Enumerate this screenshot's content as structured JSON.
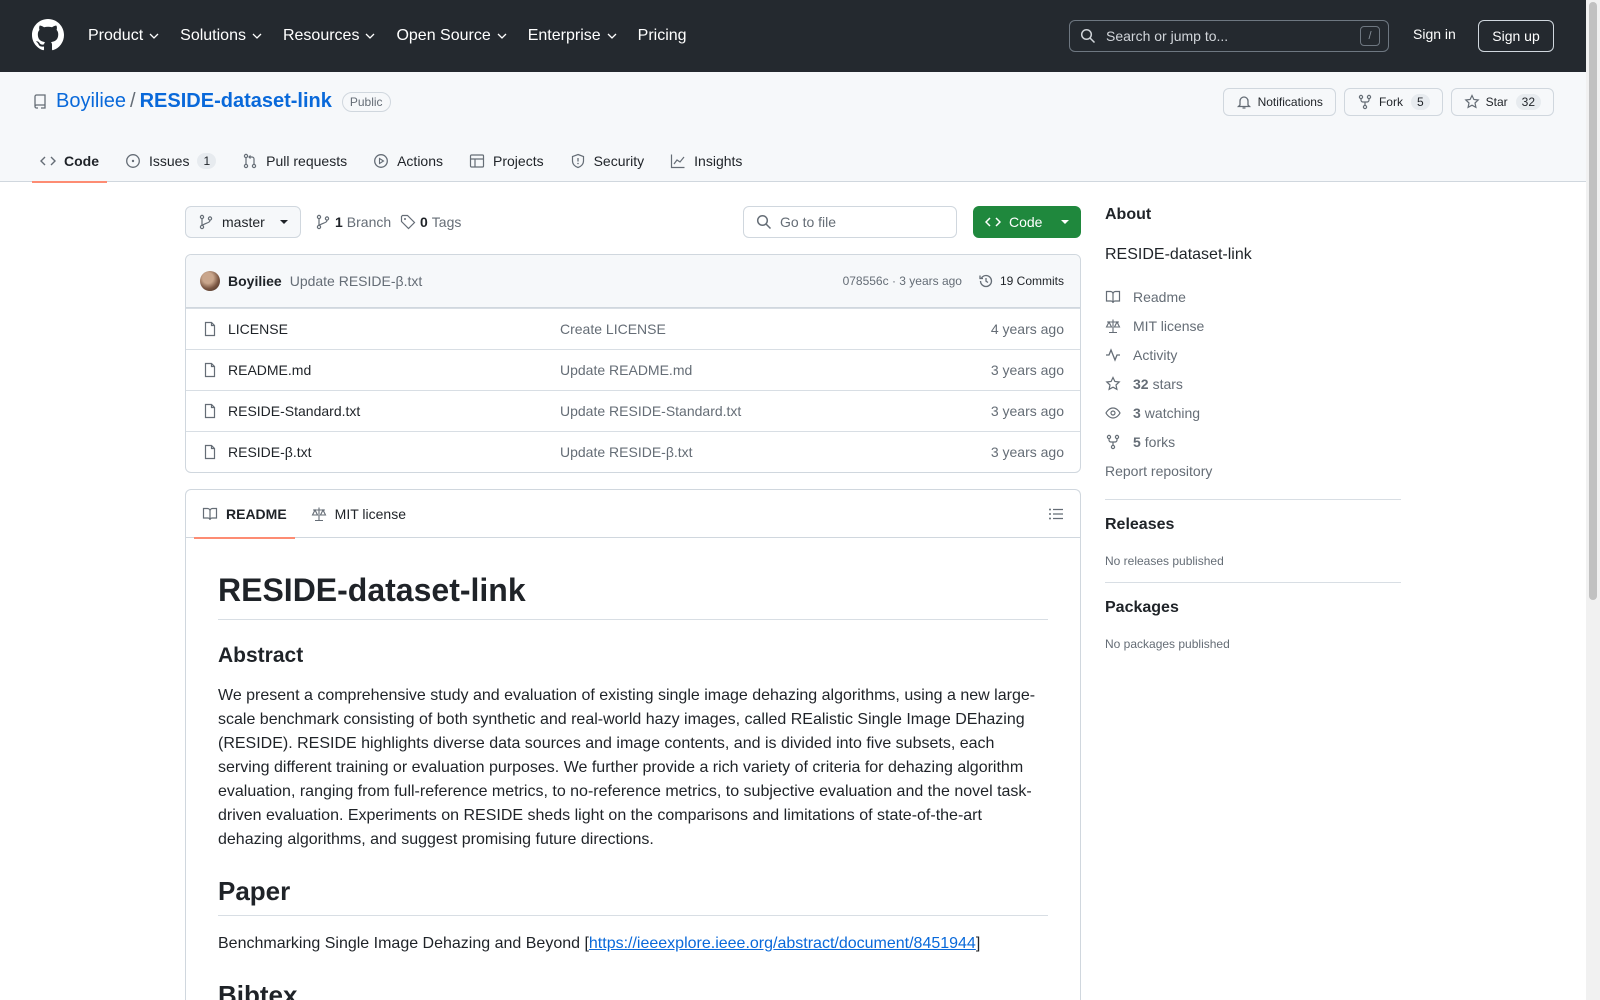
{
  "header": {
    "nav": [
      "Product",
      "Solutions",
      "Resources",
      "Open Source",
      "Enterprise",
      "Pricing"
    ],
    "search_placeholder": "Search or jump to...",
    "search_key": "/",
    "signin": "Sign in",
    "signup": "Sign up"
  },
  "repo": {
    "owner": "Boyiliee",
    "separator": "/",
    "name": "RESIDE-dataset-link",
    "visibility": "Public",
    "notifications_label": "Notifications",
    "fork_label": "Fork",
    "fork_count": "5",
    "star_label": "Star",
    "star_count": "32"
  },
  "tabs": [
    {
      "label": "Code",
      "icon": "code-icon"
    },
    {
      "label": "Issues",
      "icon": "issue-opened-icon",
      "count": "1"
    },
    {
      "label": "Pull requests",
      "icon": "git-pull-request-icon"
    },
    {
      "label": "Actions",
      "icon": "play-icon"
    },
    {
      "label": "Projects",
      "icon": "table-icon"
    },
    {
      "label": "Security",
      "icon": "shield-icon"
    },
    {
      "label": "Insights",
      "icon": "graph-icon"
    }
  ],
  "toolbar": {
    "branch": "master",
    "branch_count": "1",
    "branch_label": "Branch",
    "tag_count": "0",
    "tag_label": "Tags",
    "gofile_placeholder": "Go to file",
    "code_label": "Code"
  },
  "commit": {
    "author": "Boyiliee",
    "message": "Update RESIDE-β.txt",
    "meta": "078556c · 3 years ago",
    "commits": "19 Commits"
  },
  "files": [
    {
      "name": "LICENSE",
      "message": "Create LICENSE",
      "time": "4 years ago"
    },
    {
      "name": "README.md",
      "message": "Update README.md",
      "time": "3 years ago"
    },
    {
      "name": "RESIDE-Standard.txt",
      "message": "Update RESIDE-Standard.txt",
      "time": "3 years ago"
    },
    {
      "name": "RESIDE-β.txt",
      "message": "Update RESIDE-β.txt",
      "time": "3 years ago"
    }
  ],
  "readme": {
    "tab_readme": "README",
    "tab_license": "MIT license",
    "title": "RESIDE-dataset-link",
    "abstract_heading": "Abstract",
    "abstract": "We present a comprehensive study and evaluation of existing single image dehazing algorithms, using a new large-scale benchmark consisting of both synthetic and real-world hazy images, called REalistic Single Image DEhazing (RESIDE). RESIDE highlights diverse data sources and image contents, and is divided into five subsets, each serving different training or evaluation purposes. We further provide a rich variety of criteria for dehazing algorithm evaluation, ranging from full-reference metrics, to no-reference metrics, to subjective evaluation and the novel task-driven evaluation. Experiments on RESIDE sheds light on the comparisons and limitations of state-of-the-art dehazing algorithms, and suggest promising future directions.",
    "paper_heading": "Paper",
    "paper_text": "Benchmarking Single Image Dehazing and Beyond [",
    "paper_link": "https://ieeexplore.ieee.org/abstract/document/8451944",
    "paper_close": "]",
    "bibtex_heading": "Bibtex"
  },
  "sidebar": {
    "about_heading": "About",
    "about_desc": "RESIDE-dataset-link",
    "readme": "Readme",
    "license": "MIT license",
    "activity": "Activity",
    "stars_count": "32",
    "stars_label": "stars",
    "watching_count": "3",
    "watching_label": "watching",
    "forks_count": "5",
    "forks_label": "forks",
    "report": "Report repository",
    "releases_heading": "Releases",
    "releases_text": "No releases published",
    "packages_heading": "Packages",
    "packages_text": "No packages published"
  },
  "colors": {
    "header_bg": "#24292f",
    "link": "#0969da",
    "code_button": "#1f883d",
    "active_tab_underline": "#fd8c73"
  }
}
